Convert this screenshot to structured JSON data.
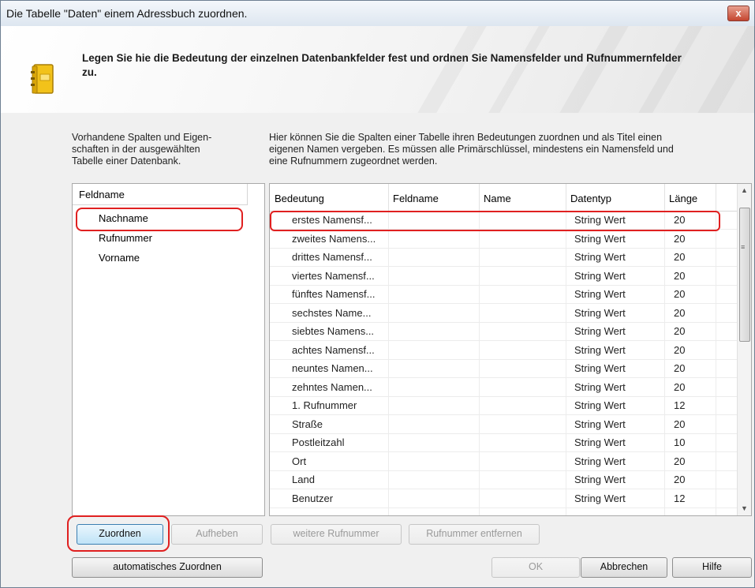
{
  "window": {
    "title": "Die Tabelle \"Daten\"  einem Adressbuch zuordnen.",
    "close_label": "x"
  },
  "header": {
    "heading": "Legen Sie hie die Bedeutung der einzelnen Datenbankfelder fest und ordnen Sie Namensfelder und Rufnummernfelder zu."
  },
  "left_description": [
    "Vorhandene Spalten und Eigen-",
    "schaften in der ausgewählten",
    "Tabelle einer Datenbank."
  ],
  "right_description": [
    "Hier können Sie die Spalten einer Tabelle ihren Bedeutungen zuordnen und als Titel einen",
    "eigenen Namen vergeben. Es müssen alle Primärschlüssel, mindestens ein Namensfeld und",
    "eine Rufnummern zugeordnet werden."
  ],
  "field_list": {
    "header": "Feldname",
    "items": [
      "Nachname",
      "Rufnummer",
      "Vorname"
    ]
  },
  "grid": {
    "columns": [
      "Bedeutung",
      "Feldname",
      "Name",
      "Datentyp",
      "Länge"
    ],
    "rows": [
      {
        "bedeutung": "erstes Namensf...",
        "feldname": "",
        "name": "",
        "datentyp": "String Wert",
        "laenge": "20"
      },
      {
        "bedeutung": "zweites Namens...",
        "feldname": "",
        "name": "",
        "datentyp": "String Wert",
        "laenge": "20"
      },
      {
        "bedeutung": "drittes Namensf...",
        "feldname": "",
        "name": "",
        "datentyp": "String Wert",
        "laenge": "20"
      },
      {
        "bedeutung": "viertes Namensf...",
        "feldname": "",
        "name": "",
        "datentyp": "String Wert",
        "laenge": "20"
      },
      {
        "bedeutung": "fünftes Namensf...",
        "feldname": "",
        "name": "",
        "datentyp": "String Wert",
        "laenge": "20"
      },
      {
        "bedeutung": "sechstes Name...",
        "feldname": "",
        "name": "",
        "datentyp": "String Wert",
        "laenge": "20"
      },
      {
        "bedeutung": "siebtes Namens...",
        "feldname": "",
        "name": "",
        "datentyp": "String Wert",
        "laenge": "20"
      },
      {
        "bedeutung": "achtes Namensf...",
        "feldname": "",
        "name": "",
        "datentyp": "String Wert",
        "laenge": "20"
      },
      {
        "bedeutung": "neuntes Namen...",
        "feldname": "",
        "name": "",
        "datentyp": "String Wert",
        "laenge": "20"
      },
      {
        "bedeutung": "zehntes Namen...",
        "feldname": "",
        "name": "",
        "datentyp": "String Wert",
        "laenge": "20"
      },
      {
        "bedeutung": "1. Rufnummer",
        "feldname": "",
        "name": "",
        "datentyp": "String Wert",
        "laenge": "12"
      },
      {
        "bedeutung": "Straße",
        "feldname": "",
        "name": "",
        "datentyp": "String Wert",
        "laenge": "20"
      },
      {
        "bedeutung": "Postleitzahl",
        "feldname": "",
        "name": "",
        "datentyp": "String Wert",
        "laenge": "10"
      },
      {
        "bedeutung": "Ort",
        "feldname": "",
        "name": "",
        "datentyp": "String Wert",
        "laenge": "20"
      },
      {
        "bedeutung": "Land",
        "feldname": "",
        "name": "",
        "datentyp": "String Wert",
        "laenge": "20"
      },
      {
        "bedeutung": "Benutzer",
        "feldname": "",
        "name": "",
        "datentyp": "String Wert",
        "laenge": "12"
      }
    ]
  },
  "scrollbar": {
    "up": "▲",
    "down": "▼",
    "grip": "≡"
  },
  "buttons": {
    "zuordnen": "Zuordnen",
    "aufheben": "Aufheben",
    "weitere_rufnummer": "weitere Rufnummer",
    "rufnummer_entfernen": "Rufnummer entfernen",
    "automatisches_zuordnen": "automatisches Zuordnen",
    "ok": "OK",
    "abbrechen": "Abbrechen",
    "hilfe": "Hilfe"
  },
  "icons": {
    "address_book": "address-book-icon",
    "close": "close-icon"
  },
  "colors": {
    "highlight_annotation": "#e02020",
    "default_button": "#bfe3f7"
  }
}
